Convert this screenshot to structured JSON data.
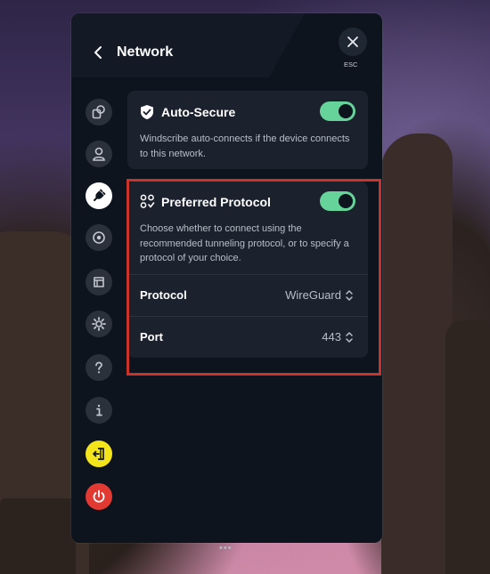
{
  "window": {
    "title": "Network",
    "esc_label": "ESC"
  },
  "sidebar": {
    "items": [
      {
        "name": "connection",
        "icon": "connection-icon"
      },
      {
        "name": "account",
        "icon": "account-icon"
      },
      {
        "name": "network",
        "icon": "network-plug-icon",
        "active": true
      },
      {
        "name": "robert",
        "icon": "target-icon"
      },
      {
        "name": "cube",
        "icon": "cube-icon"
      },
      {
        "name": "general",
        "icon": "gear-icon"
      },
      {
        "name": "help",
        "icon": "help-icon"
      },
      {
        "name": "about",
        "icon": "info-icon"
      },
      {
        "name": "logout",
        "icon": "logout-icon"
      },
      {
        "name": "quit",
        "icon": "power-icon"
      }
    ]
  },
  "auto_secure": {
    "title": "Auto-Secure",
    "description": "Windscribe auto-connects if the device connects to this network.",
    "enabled": true
  },
  "preferred_protocol": {
    "title": "Preferred Protocol",
    "description": "Choose whether to connect using the recommended tunneling protocol, or to specify a protocol of your choice.",
    "enabled": true,
    "protocol_label": "Protocol",
    "protocol_value": "WireGuard",
    "port_label": "Port",
    "port_value": "443"
  },
  "colors": {
    "accent_green": "#66d39a",
    "highlight_red": "#c9332a",
    "logout_yellow": "#f4e41c",
    "power_red": "#e23a33"
  }
}
